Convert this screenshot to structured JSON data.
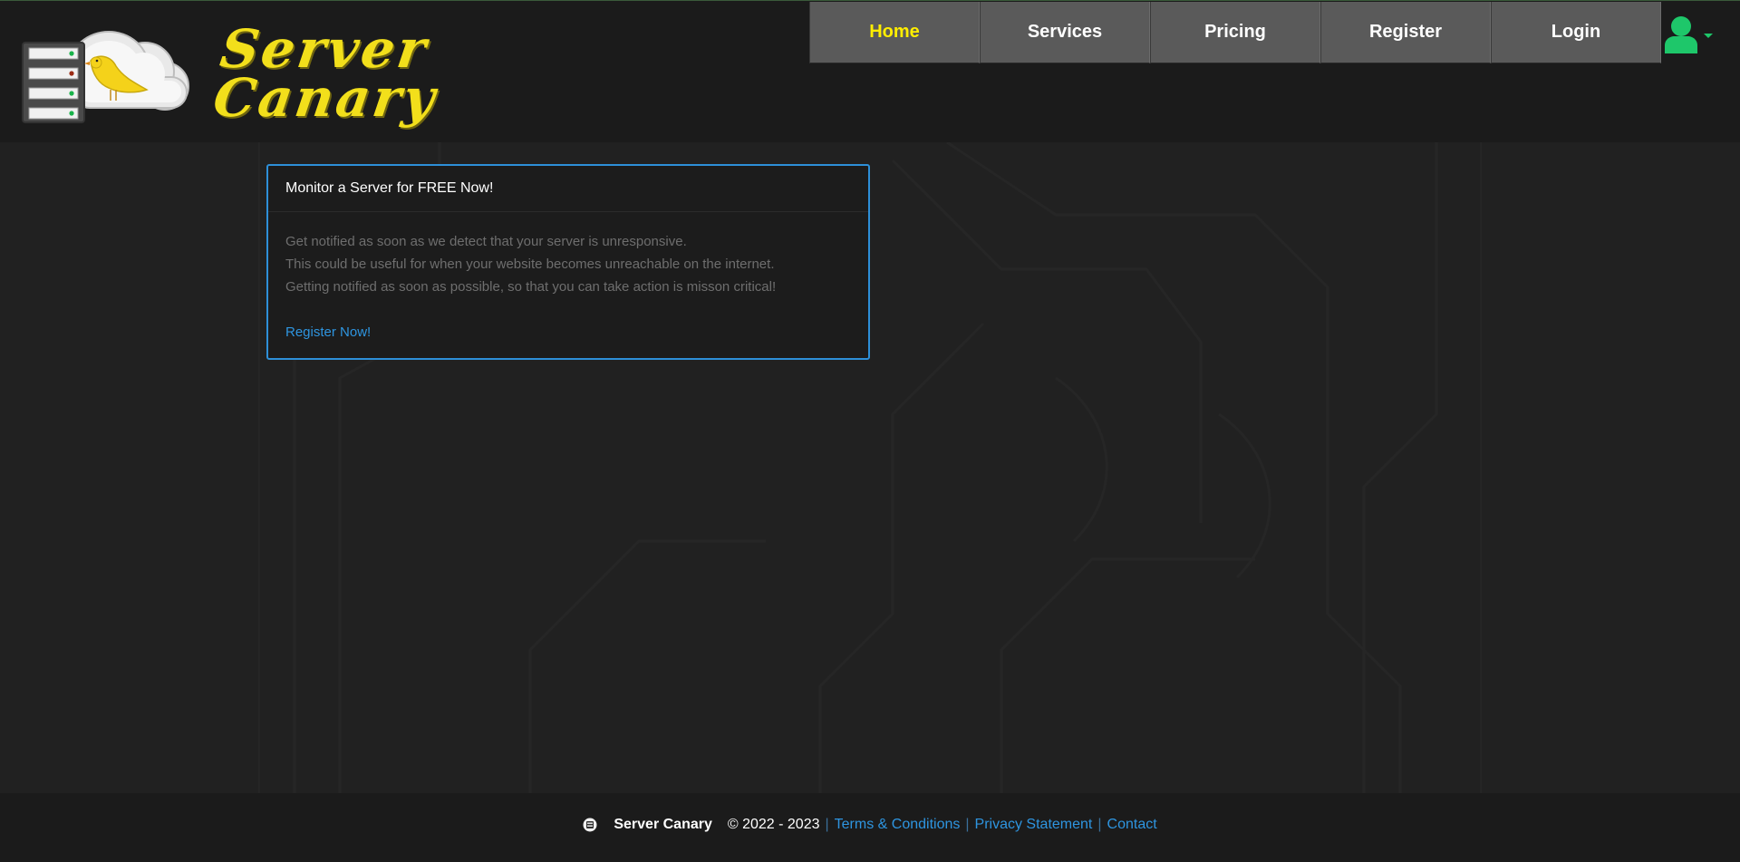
{
  "brand": {
    "line1": "Server",
    "line2": "Canary"
  },
  "nav": {
    "items": [
      {
        "label": "Home",
        "active": true
      },
      {
        "label": "Services",
        "active": false
      },
      {
        "label": "Pricing",
        "active": false
      },
      {
        "label": "Register",
        "active": false
      },
      {
        "label": "Login",
        "active": false
      }
    ]
  },
  "user_menu": {
    "icon": "user-icon",
    "accent_color": "#1ec76a"
  },
  "card": {
    "title": "Monitor a Server for FREE Now!",
    "lines": [
      "Get notified as soon as we detect that your server is unresponsive.",
      "This could be useful for when your website becomes unreachable on the internet.",
      "Getting notified as soon as possible, so that you can take action is misson critical!"
    ],
    "link": "Register Now!",
    "border_color": "#2d8fd8"
  },
  "footer": {
    "brand": "Server Canary",
    "copyright": "© 2022 - 2023",
    "links": [
      "Terms & Conditions",
      "Privacy Statement",
      "Contact"
    ]
  },
  "colors": {
    "active_nav": "#ffee00",
    "link": "#2e95e0",
    "logo_text": "#f2df1b"
  }
}
